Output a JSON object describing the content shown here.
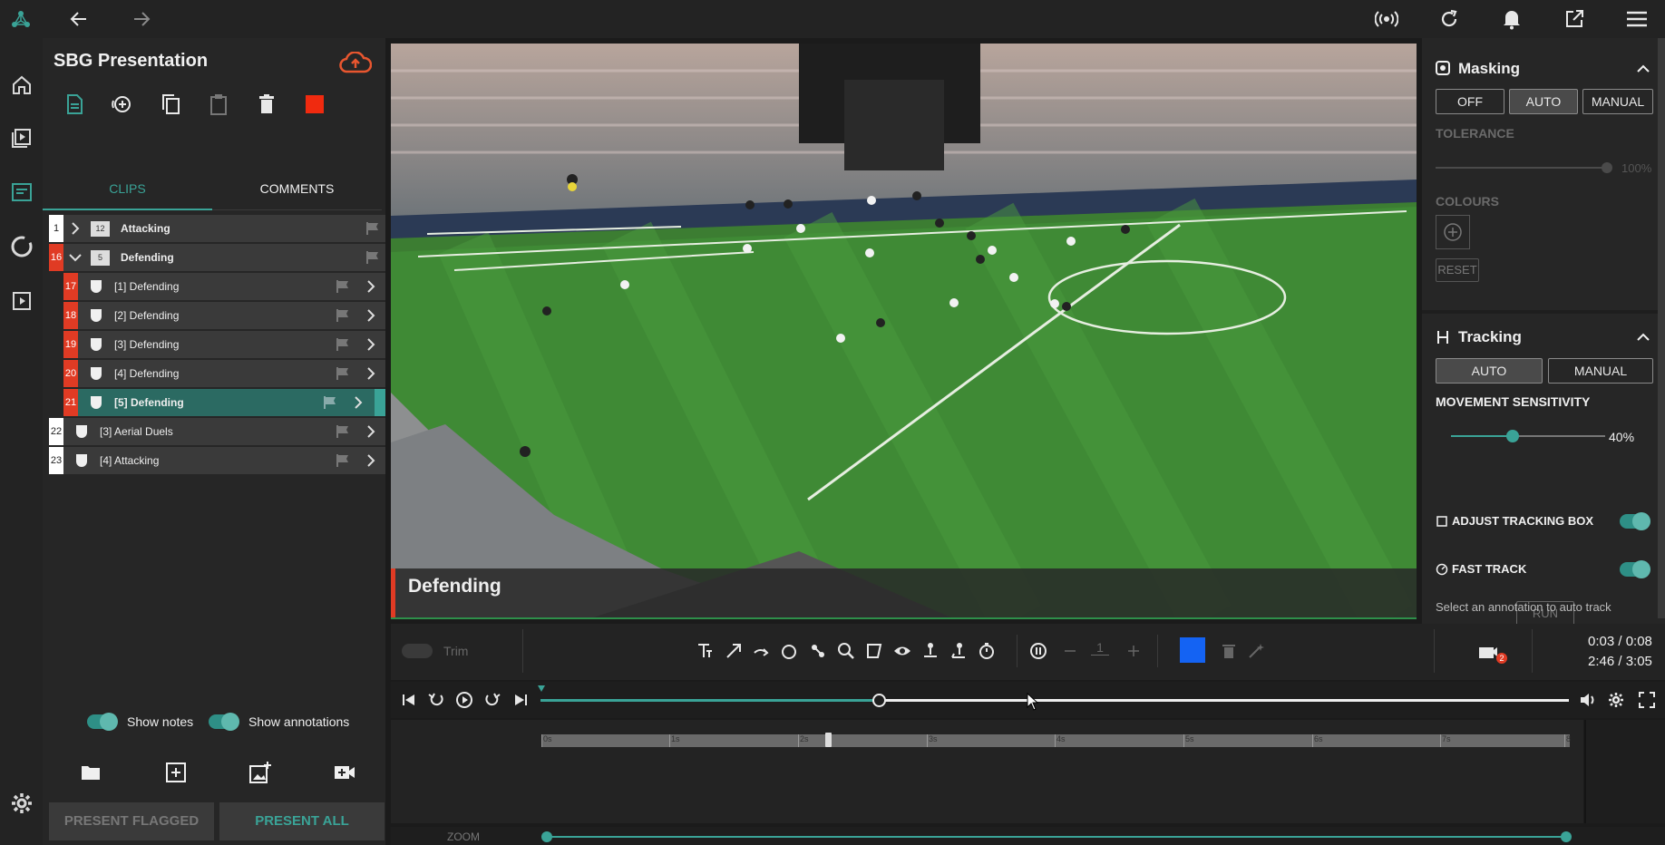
{
  "presentation_title": "SBG Presentation",
  "tabs": [
    {
      "label": "CLIPS",
      "active": true
    },
    {
      "label": "COMMENTS",
      "active": false
    }
  ],
  "clips": [
    {
      "num": "1",
      "count": "12",
      "label": "Attacking",
      "type": "group",
      "expanded": false
    },
    {
      "num": "16",
      "count": "5",
      "label": "Defending",
      "type": "group",
      "expanded": true
    },
    {
      "num": "17",
      "label": "[1] Defending",
      "type": "child"
    },
    {
      "num": "18",
      "label": "[2] Defending",
      "type": "child"
    },
    {
      "num": "19",
      "label": "[3] Defending",
      "type": "child"
    },
    {
      "num": "20",
      "label": "[4] Defending",
      "type": "child"
    },
    {
      "num": "21",
      "label": "[5] Defending",
      "type": "child",
      "selected": true
    },
    {
      "num": "22",
      "label": "[3] Aerial Duels",
      "type": "clip"
    },
    {
      "num": "23",
      "label": "[4] Attacking",
      "type": "clip"
    }
  ],
  "toggles": {
    "show_notes": "Show notes",
    "show_annotations": "Show annotations"
  },
  "buttons": {
    "present_flagged": "PRESENT FLAGGED",
    "present_all": "PRESENT ALL"
  },
  "video_caption": "Defending",
  "masking": {
    "title": "Masking",
    "modes": [
      "OFF",
      "AUTO",
      "MANUAL"
    ],
    "active_mode": "AUTO",
    "tolerance_label": "TOLERANCE",
    "tolerance_value": "100%",
    "colours_label": "COLOURS",
    "reset_label": "RESET"
  },
  "tracking": {
    "title": "Tracking",
    "modes": [
      "AUTO",
      "MANUAL"
    ],
    "active_mode": "AUTO",
    "sensitivity_label": "MOVEMENT SENSITIVITY",
    "sensitivity_value": "40%",
    "sensitivity_fraction": 0.4,
    "adjust_label": "ADJUST TRACKING BOX",
    "fast_label": "FAST TRACK",
    "run_label": "RUN",
    "hint": "Select an annotation to auto track"
  },
  "controls": {
    "trim_label": "Trim",
    "stroke_value": "1",
    "camera_badge": "2",
    "time_clip": "0:03 / 0:08",
    "time_total": "2:46 / 3:05",
    "playhead_fraction": 0.33,
    "colour": "#1463f3"
  },
  "timeline": {
    "ticks": [
      "0s",
      "1s",
      "2s",
      "3s",
      "4s",
      "5s",
      "6s",
      "7s",
      "8"
    ],
    "zoom_label": "ZOOM"
  },
  "colors": {
    "accent": "#3aa397",
    "red": "#e03b24",
    "cloud": "#e8562f"
  }
}
